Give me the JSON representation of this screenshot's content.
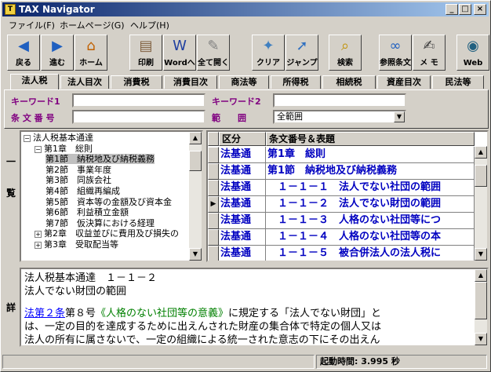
{
  "window": {
    "title": "TAX Navigator",
    "app_icon_letter": "T",
    "min_glyph": "_",
    "max_glyph": "□",
    "close_glyph": "×"
  },
  "menu": [
    "ファイル(F)",
    "ホームページ(G)",
    "ヘルプ(H)"
  ],
  "toolbar": [
    {
      "label": "戻る",
      "icon": "back-icon",
      "glyph": "◀",
      "color": "#2060c0"
    },
    {
      "label": "進む",
      "icon": "forward-icon",
      "glyph": "▶",
      "color": "#2060c0"
    },
    {
      "label": "ホーム",
      "icon": "home-icon",
      "glyph": "⌂",
      "color": "#c06000"
    },
    {
      "label": "印刷",
      "icon": "printer-icon",
      "glyph": "▤",
      "color": "#806040"
    },
    {
      "label": "Wordへ",
      "icon": "word-icon",
      "glyph": "W",
      "color": "#2040a0"
    },
    {
      "label": "全て開く",
      "icon": "open-all-icon",
      "glyph": "✎",
      "color": "#808080"
    },
    {
      "label": "クリア",
      "icon": "eraser-icon",
      "glyph": "✦",
      "color": "#4080c0"
    },
    {
      "label": "ジャンプ",
      "icon": "jump-icon",
      "glyph": "➚",
      "color": "#3070c0"
    },
    {
      "label": "検索",
      "icon": "magnifier-icon",
      "glyph": "⌕",
      "color": "#c09000"
    },
    {
      "label": "参照条文",
      "icon": "reference-icon",
      "glyph": "∞",
      "color": "#2060c0"
    },
    {
      "label": "メ モ",
      "icon": "memo-icon",
      "glyph": "✍",
      "color": "#404040"
    },
    {
      "label": "Web",
      "icon": "globe-icon",
      "glyph": "◉",
      "color": "#206080"
    }
  ],
  "tabs": [
    "法人税",
    "法人目次",
    "消費税",
    "消費目次",
    "商法等",
    "所得税",
    "相続税",
    "資産目次",
    "民法等"
  ],
  "active_tab": "法人税",
  "search": {
    "keyword1_label": "キーワード1",
    "keyword1_value": "",
    "keyword2_label": "キーワード2",
    "keyword2_value": "",
    "article_label": "条 文 番 号",
    "article_value": "",
    "range_label": "範　　囲",
    "range_value": "全範囲"
  },
  "side_labels": {
    "list": [
      "一",
      "覧"
    ],
    "detail": [
      "詳"
    ]
  },
  "tree": [
    {
      "text": "法人税基本通達",
      "expander": "−",
      "level": 0
    },
    {
      "text": "第1章　総則",
      "expander": "−",
      "level": 1
    },
    {
      "text": "第1節　納税地及び納税義務",
      "expander": "",
      "level": 2,
      "selected": true
    },
    {
      "text": "第2節　事業年度",
      "expander": "",
      "level": 2
    },
    {
      "text": "第3節　同族会社",
      "expander": "",
      "level": 2
    },
    {
      "text": "第4節　組織再編成",
      "expander": "",
      "level": 2
    },
    {
      "text": "第5節　資本等の金額及び資本金",
      "expander": "",
      "level": 2
    },
    {
      "text": "第6節　利益積立金額",
      "expander": "",
      "level": 2
    },
    {
      "text": "第7節　仮決算における経理",
      "expander": "",
      "level": 2
    },
    {
      "text": "第2章　収益並びに費用及び損失の",
      "expander": "+",
      "level": 1
    },
    {
      "text": "第3章　受取配当等",
      "expander": "+",
      "level": 1
    }
  ],
  "grid": {
    "headers": [
      "区分",
      "条文番号＆表題"
    ],
    "rows": [
      {
        "kubun": "法基通",
        "title": "第1章　総則"
      },
      {
        "kubun": "法基通",
        "title": "第1節　納税地及び納税義務"
      },
      {
        "kubun": "法基通",
        "title": "　１－１－１　法人でない社団の範囲"
      },
      {
        "kubun": "法基通",
        "title": "　１－１－２　法人でない財団の範囲",
        "current": true
      },
      {
        "kubun": "法基通",
        "title": "　１－１－３　人格のない社団等につ"
      },
      {
        "kubun": "法基通",
        "title": "　１－１－４　人格のない社団等の本"
      },
      {
        "kubun": "法基通",
        "title": "　１－１－５　被合併法人の法人税に"
      }
    ],
    "current_marker": "▶"
  },
  "detail": {
    "line1": "法人税基本通達　１－１－２",
    "line2": "法人でない財団の範囲",
    "link1": "法第２条",
    "mid1": "第８号",
    "link2": "《人格のない社団等の意義》",
    "rest1": "に規定する「法人でない財団」と",
    "line4": "は、一定の目的を達成するために出えんされた財産の集合体で特定の個人又は",
    "line5": "法人の所有に属さないで、一定の組織による統一された意志の下にその出えん"
  },
  "status": {
    "label": "起動時間: 3.995 秒"
  },
  "colors": {
    "title_start": "#0a246a",
    "title_end": "#a6caf0",
    "label_purple": "#800080",
    "grid_text": "#0000c0",
    "link_blue": "#0000ff",
    "link_green": "#008000"
  }
}
